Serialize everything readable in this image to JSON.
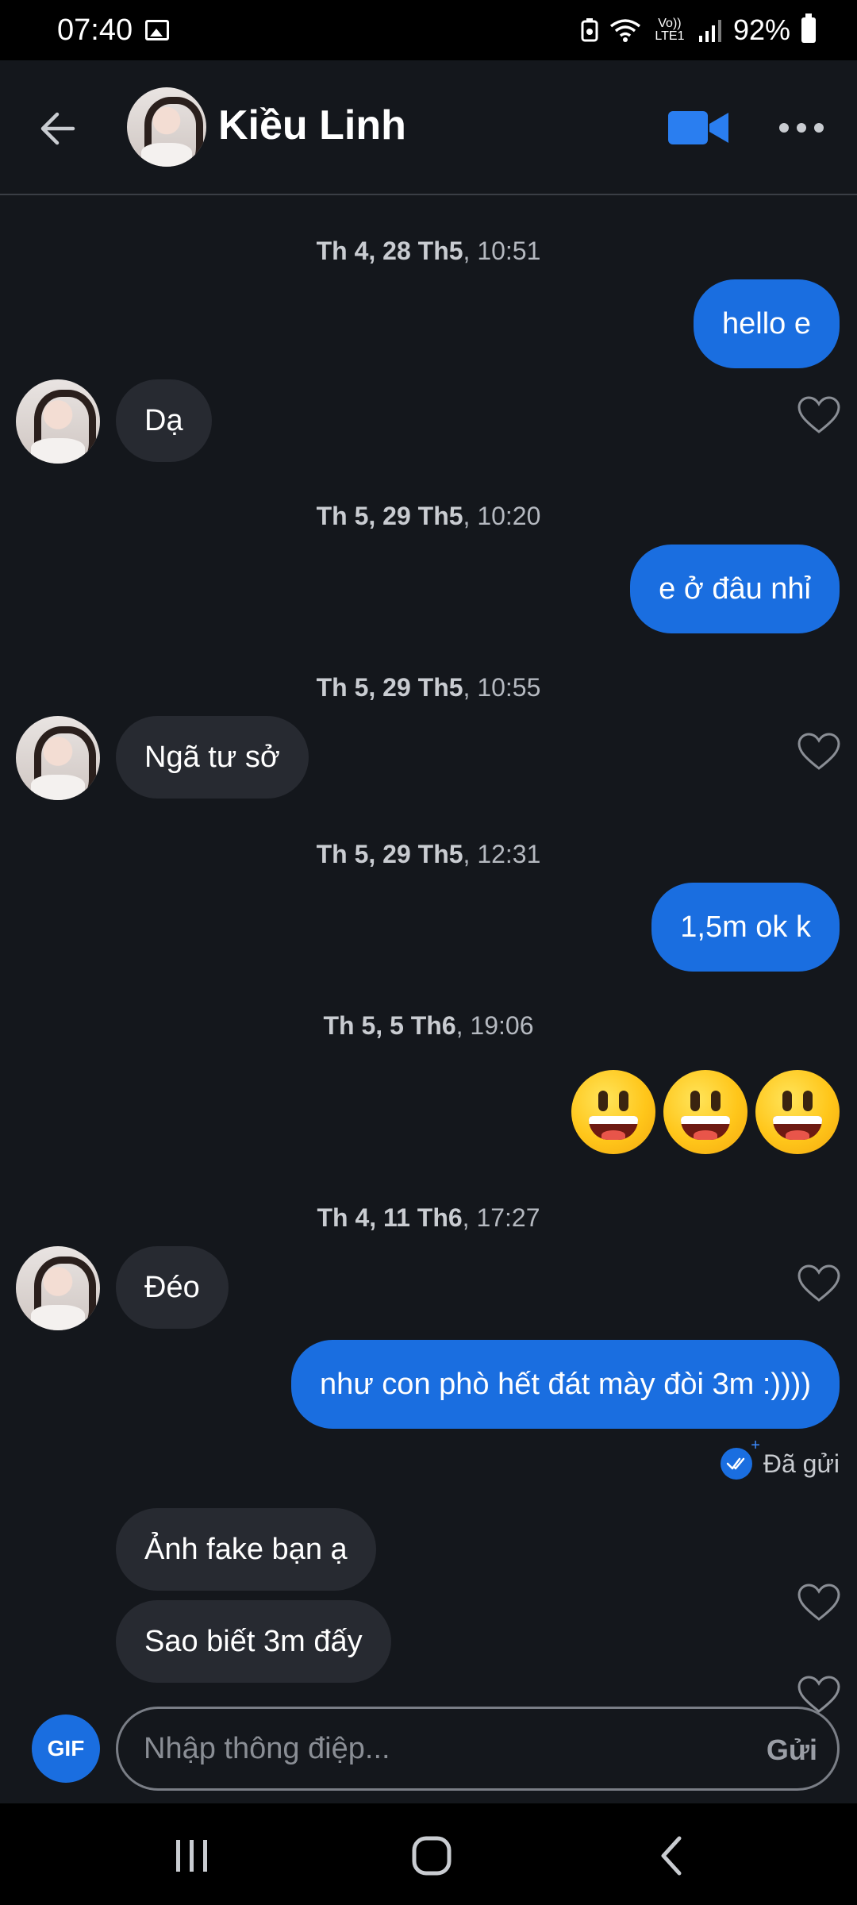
{
  "status_bar": {
    "time": "07:40",
    "network_label": "Vo)) LTE1",
    "battery": "92%"
  },
  "header": {
    "contact_name": "Kiều Linh",
    "icons": {
      "back": "back-arrow-icon",
      "video": "video-call-icon",
      "more": "more-options-icon"
    }
  },
  "messages": [
    {
      "type": "timestamp",
      "day": "Th 4, 28 Th5",
      "time": ", 10:51"
    },
    {
      "type": "out",
      "text": "hello e"
    },
    {
      "type": "in",
      "text": "Dạ"
    },
    {
      "type": "timestamp",
      "day": "Th 5, 29 Th5",
      "time": ", 10:20"
    },
    {
      "type": "out",
      "text": "e ở đâu nhỉ"
    },
    {
      "type": "timestamp",
      "day": "Th 5, 29 Th5",
      "time": ", 10:55"
    },
    {
      "type": "in",
      "text": "Ngã tư sở"
    },
    {
      "type": "timestamp",
      "day": "Th 5, 29 Th5",
      "time": ", 12:31"
    },
    {
      "type": "out",
      "text": "1,5m ok k"
    },
    {
      "type": "timestamp",
      "day": "Th 5, 5 Th6",
      "time": ", 19:06"
    },
    {
      "type": "out-emoji",
      "emoji": "grinning-face",
      "count": 3
    },
    {
      "type": "timestamp",
      "day": "Th 4, 11 Th6",
      "time": ", 17:27"
    },
    {
      "type": "in",
      "text": "Đéo"
    },
    {
      "type": "out",
      "text": "như con phò hết đát mày đòi 3m :))))"
    },
    {
      "type": "status",
      "text": "Đã gửi"
    },
    {
      "type": "in",
      "text": "Ảnh fake bạn ạ"
    },
    {
      "type": "in",
      "text": "Sao biết 3m đấy"
    }
  ],
  "composer": {
    "gif_label": "GIF",
    "placeholder": "Nhập thông điệp...",
    "send_label": "Gửi"
  },
  "colors": {
    "background": "#14171c",
    "outgoing_bubble": "#1a6ee0",
    "incoming_bubble": "#272a31"
  }
}
